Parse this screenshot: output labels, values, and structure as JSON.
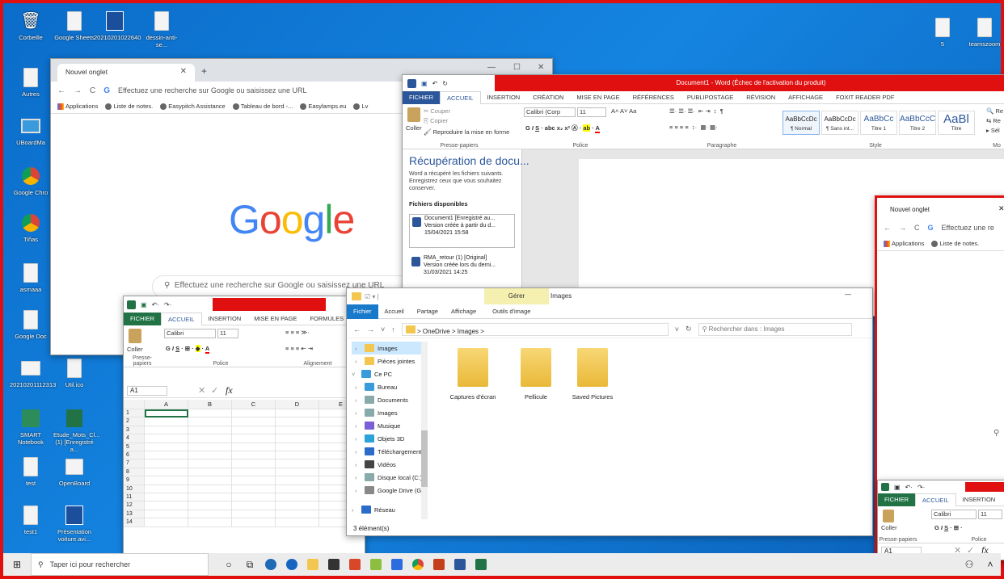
{
  "desktop_icons": [
    {
      "label": "Corbeille"
    },
    {
      "label": "Google Sheets"
    },
    {
      "label": "20210201022640"
    },
    {
      "label": "dessin-anti-se..."
    },
    {
      "label": "Autres"
    },
    {
      "label": "UBoardMa"
    },
    {
      "label": "Google Chro"
    },
    {
      "label": "Tiñas"
    },
    {
      "label": "asmaaa"
    },
    {
      "label": "Google Doc"
    },
    {
      "label": "20210201112313"
    },
    {
      "label": "Util.ico"
    },
    {
      "label": "SMART Notebook"
    },
    {
      "label": "Etude_Mots_Cl... (1) [Enregistré a..."
    },
    {
      "label": "test"
    },
    {
      "label": "OpenBoard"
    },
    {
      "label": "test1"
    },
    {
      "label": "Présentation voiture.avi..."
    },
    {
      "label": "5"
    },
    {
      "label": "teamszoom"
    }
  ],
  "chrome1": {
    "tab": "Nouvel onglet",
    "omnibox": "Effectuez une recherche sur Google ou saisissez une URL",
    "bookmarks": [
      "Applications",
      "Liste de notes.",
      "Easypitch Assistance",
      "Tableau de bord -...",
      "Easylamps.eu",
      "Lv"
    ],
    "logo": "Google",
    "search": "Effectuez une recherche sur Google ou saisissez une URL"
  },
  "word": {
    "title": "Document1 - Word (Échec de l'activation du produit)",
    "tabs": [
      "FICHIER",
      "ACCUEIL",
      "INSERTION",
      "CRÉATION",
      "MISE EN PAGE",
      "RÉFÉRENCES",
      "PUBLIPOSTAGE",
      "RÉVISION",
      "AFFICHAGE",
      "FOXIT READER PDF"
    ],
    "clipboard": {
      "cut": "Couper",
      "copy": "Copier",
      "paste": "Coller",
      "format": "Reproduire la mise en forme",
      "group": "Presse-papiers"
    },
    "font": {
      "name": "Calibri (Corp",
      "size": "11",
      "group": "Police"
    },
    "para_group": "Paragraphe",
    "styles": [
      {
        "preview": "AaBbCcDc",
        "name": "¶ Normal"
      },
      {
        "preview": "AaBbCcDc",
        "name": "¶ Sans int..."
      },
      {
        "preview": "AaBbCc",
        "name": "Titre 1"
      },
      {
        "preview": "AaBbCcC",
        "name": "Titre 2"
      },
      {
        "preview": "AaBl",
        "name": "Titre"
      }
    ],
    "style_group": "Style",
    "edit_items": [
      "Re",
      "Re",
      "Sél"
    ],
    "edit_group": "Mo",
    "recovery": {
      "title": "Récupération de docu...",
      "desc": "Word a récupéré les fichiers suivants. Enregistrez ceux que vous souhaitez conserver.",
      "section": "Fichiers disponibles",
      "files": [
        {
          "name": "Document1  [Enregistré au...",
          "line2": "Version créée à partir du d...",
          "date": "15/04/2021 15:58"
        },
        {
          "name": "RMA_retour (1)  [Original]",
          "line2": "Version créée lors du derni...",
          "date": "31/03/2021 14:25"
        }
      ]
    }
  },
  "excel": {
    "tabs": [
      "FICHIER",
      "ACCUEIL",
      "INSERTION",
      "MISE EN PAGE",
      "FORMULES"
    ],
    "font": "Calibri",
    "size": "11",
    "paste": "Coller",
    "groups": [
      "Presse-papiers",
      "Police",
      "Alignement"
    ],
    "namebox": "A1",
    "fx": "fx",
    "cols": [
      "A",
      "B",
      "C",
      "D",
      "E"
    ],
    "rows": [
      "1",
      "2",
      "3",
      "4",
      "5",
      "6",
      "7",
      "8",
      "9",
      "10",
      "11",
      "12",
      "13",
      "14"
    ]
  },
  "explorer": {
    "manage": "Gérer",
    "title": "Images",
    "tabs": [
      "Fichier",
      "Accueil",
      "Partage",
      "Affichage",
      "Outils d'image"
    ],
    "path": "> OneDrive > Images >",
    "search": "Rechercher dans : Images",
    "tree": [
      "Images",
      "Pièces jointes",
      "Ce PC",
      "Bureau",
      "Documents",
      "Images",
      "Musique",
      "Objets 3D",
      "Téléchargements",
      "Vidéos",
      "Disque local (C:)",
      "Google Drive (G:",
      "Réseau"
    ],
    "folders": [
      "Captures d'écran",
      "Pellicule",
      "Saved Pictures"
    ],
    "status": "3 élément(s)"
  },
  "chrome2": {
    "tab": "Nouvel onglet",
    "omnibox": "Effectuez une re",
    "bookmarks": [
      "Applications",
      "Liste de notes."
    ]
  },
  "excel2": {
    "tabs": [
      "FICHIER",
      "ACCUEIL",
      "INSERTION"
    ],
    "font": "Calibri",
    "size": "11",
    "paste": "Coller",
    "groups": [
      "Presse-papiers",
      "Police"
    ],
    "namebox": "A1",
    "fx": "fx"
  },
  "taskbar": {
    "search": "Taper ici pour rechercher"
  },
  "colors": {
    "red": "#e01010",
    "word": "#2b579a",
    "excel": "#217346"
  }
}
